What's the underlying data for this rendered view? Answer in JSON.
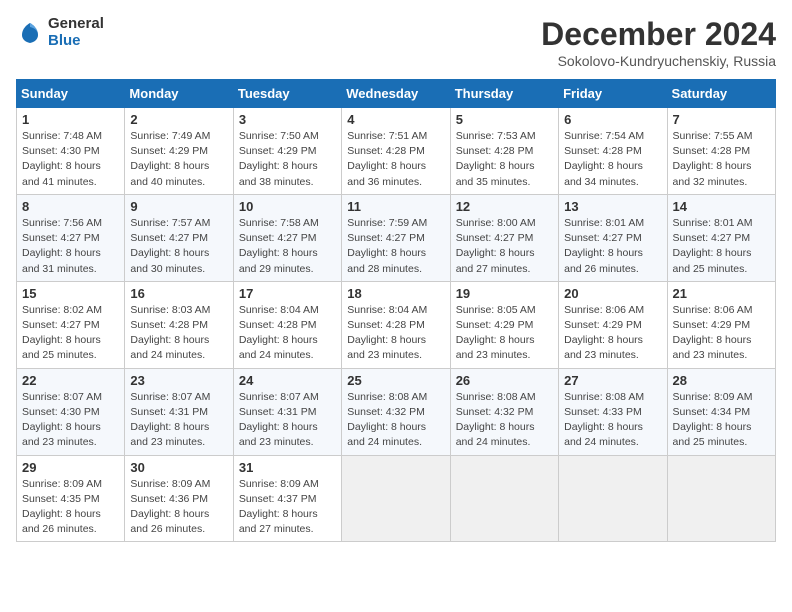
{
  "header": {
    "logo_general": "General",
    "logo_blue": "Blue",
    "month": "December 2024",
    "location": "Sokolovo-Kundryuchenskiy, Russia"
  },
  "days_of_week": [
    "Sunday",
    "Monday",
    "Tuesday",
    "Wednesday",
    "Thursday",
    "Friday",
    "Saturday"
  ],
  "weeks": [
    [
      {
        "day": "1",
        "sunrise": "7:48 AM",
        "sunset": "4:30 PM",
        "daylight": "8 hours and 41 minutes."
      },
      {
        "day": "2",
        "sunrise": "7:49 AM",
        "sunset": "4:29 PM",
        "daylight": "8 hours and 40 minutes."
      },
      {
        "day": "3",
        "sunrise": "7:50 AM",
        "sunset": "4:29 PM",
        "daylight": "8 hours and 38 minutes."
      },
      {
        "day": "4",
        "sunrise": "7:51 AM",
        "sunset": "4:28 PM",
        "daylight": "8 hours and 36 minutes."
      },
      {
        "day": "5",
        "sunrise": "7:53 AM",
        "sunset": "4:28 PM",
        "daylight": "8 hours and 35 minutes."
      },
      {
        "day": "6",
        "sunrise": "7:54 AM",
        "sunset": "4:28 PM",
        "daylight": "8 hours and 34 minutes."
      },
      {
        "day": "7",
        "sunrise": "7:55 AM",
        "sunset": "4:28 PM",
        "daylight": "8 hours and 32 minutes."
      }
    ],
    [
      {
        "day": "8",
        "sunrise": "7:56 AM",
        "sunset": "4:27 PM",
        "daylight": "8 hours and 31 minutes."
      },
      {
        "day": "9",
        "sunrise": "7:57 AM",
        "sunset": "4:27 PM",
        "daylight": "8 hours and 30 minutes."
      },
      {
        "day": "10",
        "sunrise": "7:58 AM",
        "sunset": "4:27 PM",
        "daylight": "8 hours and 29 minutes."
      },
      {
        "day": "11",
        "sunrise": "7:59 AM",
        "sunset": "4:27 PM",
        "daylight": "8 hours and 28 minutes."
      },
      {
        "day": "12",
        "sunrise": "8:00 AM",
        "sunset": "4:27 PM",
        "daylight": "8 hours and 27 minutes."
      },
      {
        "day": "13",
        "sunrise": "8:01 AM",
        "sunset": "4:27 PM",
        "daylight": "8 hours and 26 minutes."
      },
      {
        "day": "14",
        "sunrise": "8:01 AM",
        "sunset": "4:27 PM",
        "daylight": "8 hours and 25 minutes."
      }
    ],
    [
      {
        "day": "15",
        "sunrise": "8:02 AM",
        "sunset": "4:27 PM",
        "daylight": "8 hours and 25 minutes."
      },
      {
        "day": "16",
        "sunrise": "8:03 AM",
        "sunset": "4:28 PM",
        "daylight": "8 hours and 24 minutes."
      },
      {
        "day": "17",
        "sunrise": "8:04 AM",
        "sunset": "4:28 PM",
        "daylight": "8 hours and 24 minutes."
      },
      {
        "day": "18",
        "sunrise": "8:04 AM",
        "sunset": "4:28 PM",
        "daylight": "8 hours and 23 minutes."
      },
      {
        "day": "19",
        "sunrise": "8:05 AM",
        "sunset": "4:29 PM",
        "daylight": "8 hours and 23 minutes."
      },
      {
        "day": "20",
        "sunrise": "8:06 AM",
        "sunset": "4:29 PM",
        "daylight": "8 hours and 23 minutes."
      },
      {
        "day": "21",
        "sunrise": "8:06 AM",
        "sunset": "4:29 PM",
        "daylight": "8 hours and 23 minutes."
      }
    ],
    [
      {
        "day": "22",
        "sunrise": "8:07 AM",
        "sunset": "4:30 PM",
        "daylight": "8 hours and 23 minutes."
      },
      {
        "day": "23",
        "sunrise": "8:07 AM",
        "sunset": "4:31 PM",
        "daylight": "8 hours and 23 minutes."
      },
      {
        "day": "24",
        "sunrise": "8:07 AM",
        "sunset": "4:31 PM",
        "daylight": "8 hours and 23 minutes."
      },
      {
        "day": "25",
        "sunrise": "8:08 AM",
        "sunset": "4:32 PM",
        "daylight": "8 hours and 24 minutes."
      },
      {
        "day": "26",
        "sunrise": "8:08 AM",
        "sunset": "4:32 PM",
        "daylight": "8 hours and 24 minutes."
      },
      {
        "day": "27",
        "sunrise": "8:08 AM",
        "sunset": "4:33 PM",
        "daylight": "8 hours and 24 minutes."
      },
      {
        "day": "28",
        "sunrise": "8:09 AM",
        "sunset": "4:34 PM",
        "daylight": "8 hours and 25 minutes."
      }
    ],
    [
      {
        "day": "29",
        "sunrise": "8:09 AM",
        "sunset": "4:35 PM",
        "daylight": "8 hours and 26 minutes."
      },
      {
        "day": "30",
        "sunrise": "8:09 AM",
        "sunset": "4:36 PM",
        "daylight": "8 hours and 26 minutes."
      },
      {
        "day": "31",
        "sunrise": "8:09 AM",
        "sunset": "4:37 PM",
        "daylight": "8 hours and 27 minutes."
      },
      null,
      null,
      null,
      null
    ]
  ]
}
